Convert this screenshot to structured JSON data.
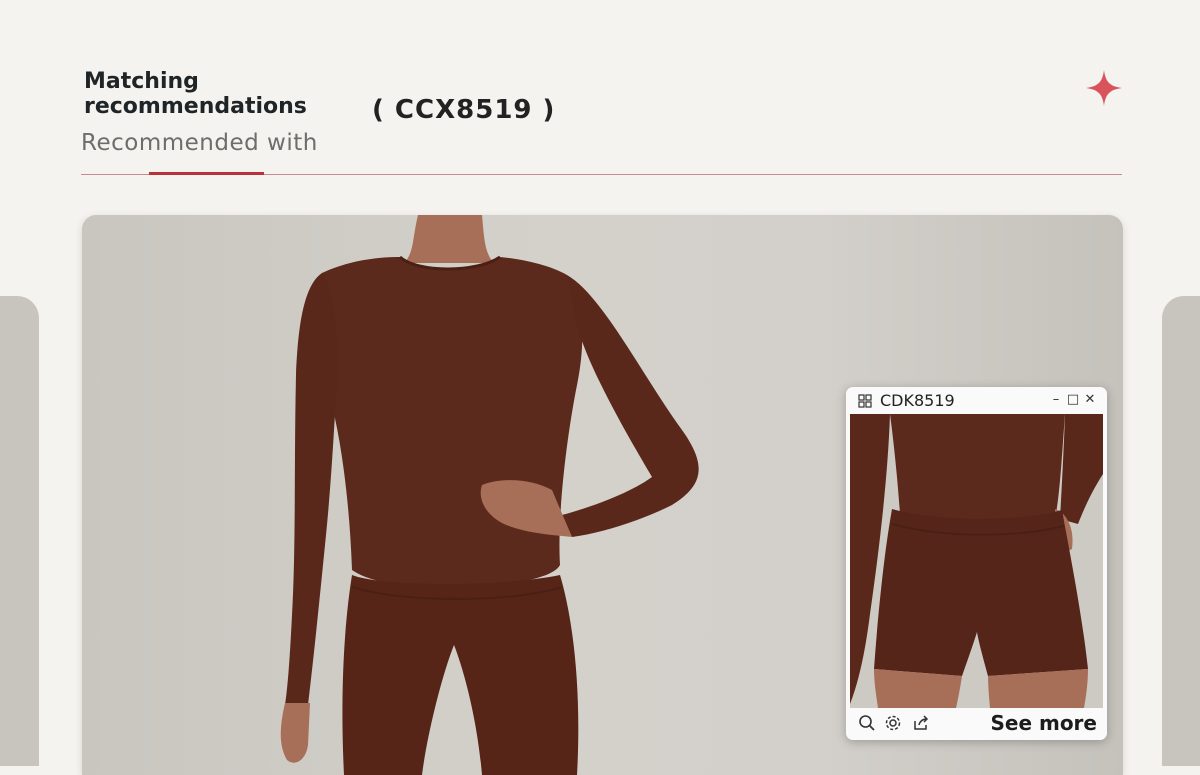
{
  "header": {
    "title": "Matching recommendations",
    "subtitle": "Recommended with",
    "product_code": "( CCX8519 )",
    "accent_color": "#b7323b",
    "star_color": "#d9535b"
  },
  "popup": {
    "title": "CDK8519",
    "see_more": "See more",
    "window_controls": {
      "minimize": "–",
      "maximize": "□",
      "close": "✕"
    },
    "footer_icons": [
      "zoom-icon",
      "settings-icon",
      "share-icon"
    ]
  },
  "product_color": "#5c2a1c"
}
